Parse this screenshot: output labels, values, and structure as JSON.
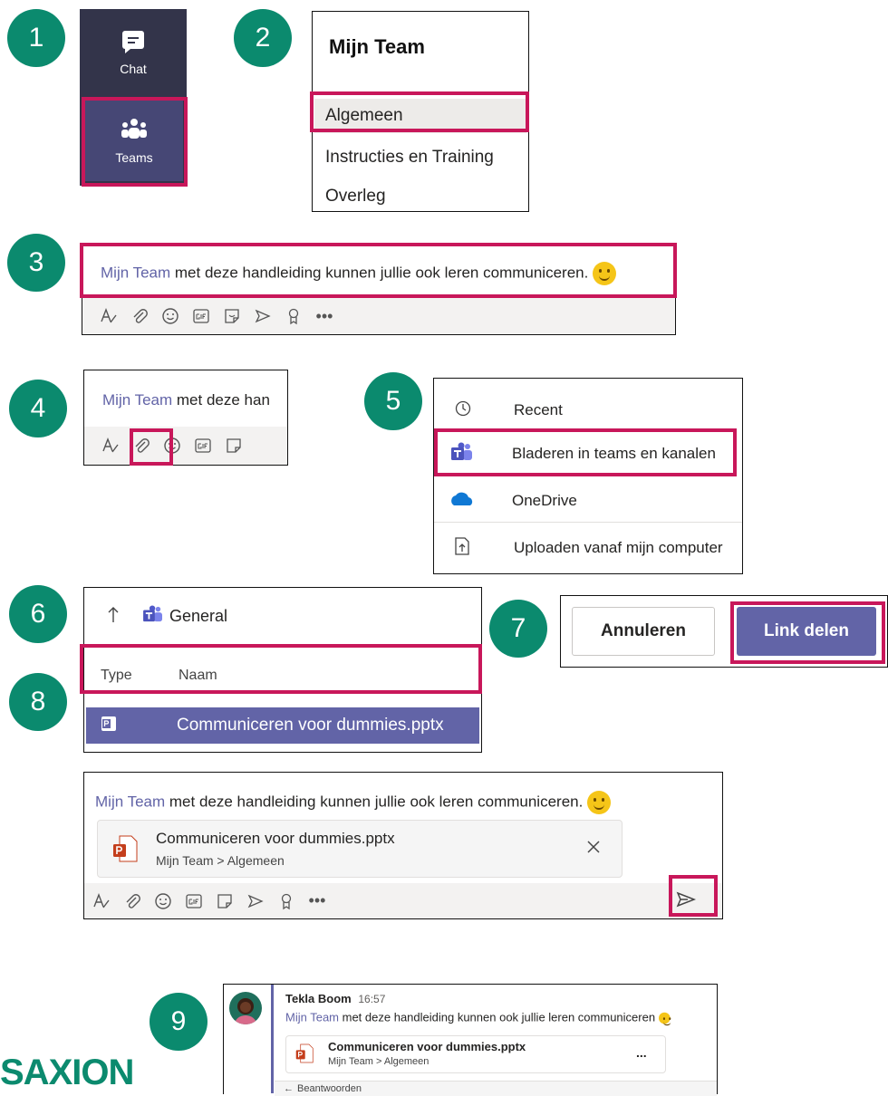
{
  "steps": [
    "1",
    "2",
    "3",
    "4",
    "5",
    "6",
    "7",
    "8",
    "9"
  ],
  "rail": {
    "chat_label": "Chat",
    "teams_label": "Teams"
  },
  "team_panel": {
    "title": "Mijn Team",
    "channels": [
      "Algemeen",
      "Instructies en Training",
      "Overleg"
    ]
  },
  "message": {
    "mention": "Mijn Team",
    "text": " met deze handleiding kunnen jullie ook leren communiceren.",
    "short_text": " met deze han"
  },
  "attach_menu": {
    "items": [
      "Recent",
      "Bladeren in teams en kanalen",
      "OneDrive",
      "Uploaden vanaf mijn computer"
    ]
  },
  "file_browser": {
    "folder": "General",
    "col_type": "Type",
    "col_name": "Naam",
    "file": "Communiceren voor dummies.pptx"
  },
  "dialog_buttons": {
    "cancel": "Annuleren",
    "share": "Link delen"
  },
  "attachment": {
    "name": "Communiceren voor dummies.pptx",
    "path": "Mijn Team > Algemeen"
  },
  "posted": {
    "author": "Tekla Boom",
    "time": "16:57",
    "mention": "Mijn Team",
    "text": " met deze handleiding kunnen ook jullie leren communiceren",
    "reply": "Beantwoorden",
    "more": "..."
  },
  "logo": {
    "text": "SAXION"
  },
  "colors": {
    "step": "#0b8a6e",
    "highlight": "#c8175a",
    "teams_purple": "#6264a7",
    "rail": "#33344a"
  }
}
